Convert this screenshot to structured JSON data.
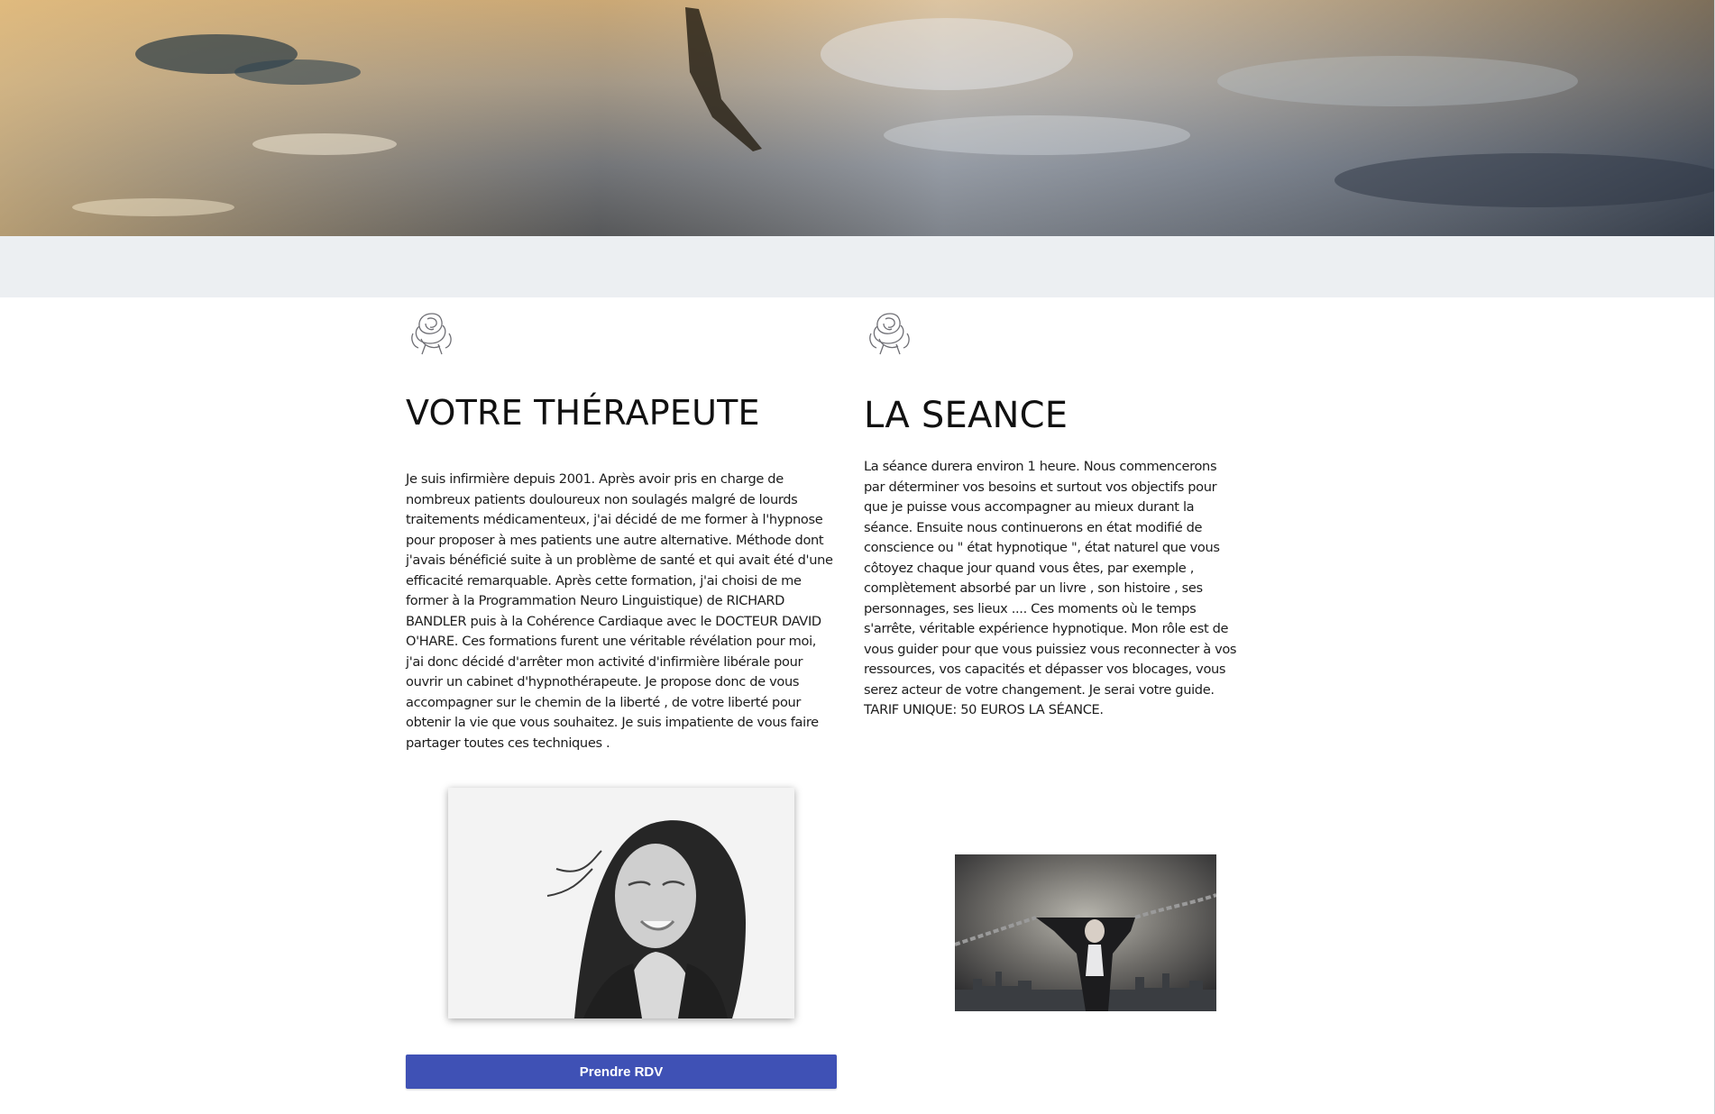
{
  "hero": {
    "image": "lake-reflection-banner"
  },
  "therapist": {
    "icon": "rose-icon",
    "title": "VOTRE THÉRAPEUTE",
    "paragraph": "Je suis infirmière depuis 2001. Après avoir pris en charge de nombreux patients douloureux non soulagés malgré de lourds traitements médicamenteux, j'ai décidé de me former à l'hypnose pour proposer à mes patients une autre alternative. Méthode dont j'avais bénéficié suite à un problème de santé et qui avait été d'une efficacité remarquable. Après cette formation, j'ai choisi de me former à la Programmation Neuro Linguistique) de RICHARD BANDLER puis à la Cohérence Cardiaque avec le DOCTEUR DAVID O'HARE. Ces formations furent une véritable révélation pour moi, j'ai donc décidé d'arrêter mon activité d'infirmière libérale pour ouvrir un cabinet d'hypnothérapeute. Je propose donc de vous accompagner sur le chemin de la liberté , de votre liberté pour obtenir la vie que vous souhaitez. Je suis impatiente de vous faire partager toutes ces techniques .",
    "photo": "therapist-portrait-photo",
    "button_label": "Prendre RDV"
  },
  "session": {
    "icon": "rose-icon",
    "title": "LA SEANCE",
    "paragraph": "La séance durera environ 1 heure. Nous commencerons par déterminer vos besoins et surtout vos objectifs pour que je puisse vous accompagner au mieux durant la séance. Ensuite nous continuerons en état modifié de conscience ou \" état hypnotique \",  état naturel que vous côtoyez chaque jour quand vous êtes, par exemple , complètement absorbé par un livre ,  son histoire ,  ses personnages,  ses lieux .... Ces moments où le temps s'arrête,   véritable expérience hypnotique.  Mon rôle  est de vous guider pour que vous puissiez vous reconnecter à vos ressources, vos capacités et dépasser vos blocages,  vous serez acteur de votre changement. Je serai votre guide.",
    "tariff": "TARIF UNIQUE: 50 EUROS LA SÉANCE.",
    "photo": "woman-breaking-chains-photo"
  },
  "colors": {
    "button": "#3f51b5",
    "band": "#eceff2"
  }
}
